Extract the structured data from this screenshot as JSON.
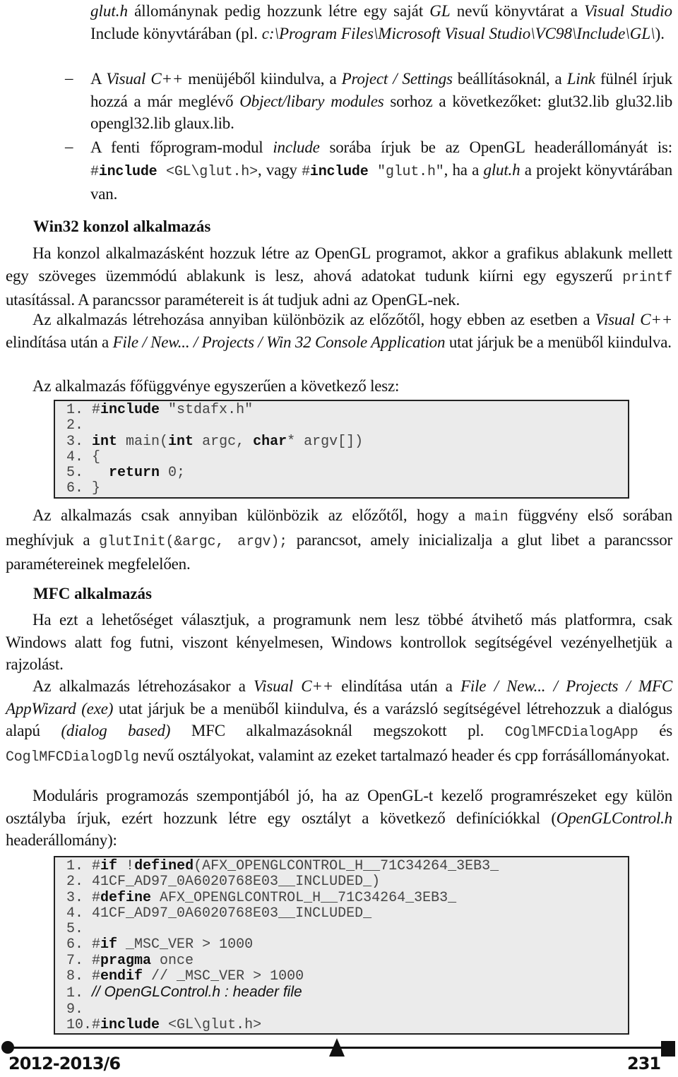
{
  "top_continuation": {
    "l1_a": "glut.h",
    "l1_b": " állománynak pedig hozzunk létre egy saját ",
    "l1_c": "GL",
    "l1_d": " nevű könyvtárat a ",
    "l1_e": "Visual Studio",
    "l1_f": " Include könyvtárában (pl. ",
    "l1_g": "c:\\Program Files\\Microsoft Visual Studio\\VC98\\Include\\GL\\",
    "l1_h": ")."
  },
  "bullets": [
    {
      "dash": "–",
      "p1": "A ",
      "i1": "Visual C++",
      "p2": " menüjéből kiindulva, a ",
      "i2": "Project / Settings",
      "p3": " beállításoknál, a ",
      "i3": "Link",
      "p4": " fülnél írjuk hozzá a már meglévő ",
      "i4": "Object/libary modules",
      "p5": " sorhoz a következőket: glut32.lib glu32.lib opengl32.lib glaux.lib."
    },
    {
      "dash": "–",
      "p1": "A fenti főprogram-modul ",
      "i1": "include",
      "p2": " sorába írjuk be az OpenGL headerállományát is: ",
      "c1_hash": "#",
      "c1_kw": "include",
      "c1_rest": " <GL\\glut.h>",
      "p3": ", vagy ",
      "c2_hash": "#",
      "c2_kw": "include",
      "c2_rest": " \"glut.h\"",
      "p4": ", ha a ",
      "i2": "glut.h",
      "p5": " a projekt könyvtárában van."
    }
  ],
  "section_win32": {
    "heading": "Win32 konzol alkalmazás",
    "para1_a": "Ha konzol alkalmazásként hozzuk létre az OpenGL programot, akkor a grafikus ablakunk mellett egy szöveges üzemmódú ablakunk is lesz, ahová adatokat tudunk kiírni egy egyszerű ",
    "para1_code": "printf",
    "para1_b": " utasítással. A parancssor paramétereit is át tudjuk adni az OpenGL-nek.",
    "para2_a": "Az alkalmazás létrehozása annyiban különbözik az előzőtől, hogy ebben az esetben a ",
    "para2_i1": "Visual C++",
    "para2_b": " elindítása után a ",
    "para2_i2": "File / New... / Projects / Win 32 Console Application",
    "para2_c": " utat járjuk be a menüből kiindulva.",
    "para3": "Az alkalmazás főfüggvénye egyszerűen a következő lesz:",
    "code": [
      {
        "num": "1. ",
        "hash": "#",
        "kw": "include",
        "rest": " \"stdafx.h\""
      },
      {
        "num": "2. ",
        "hash": "",
        "kw": "",
        "rest": ""
      },
      {
        "num": "3. ",
        "kw1": "int",
        "r1": " main(",
        "kw2": "int",
        "r2": " argc, ",
        "kw3": "char",
        "r3": "* argv[])"
      },
      {
        "num": "4. ",
        "hash": "",
        "kw": "",
        "rest": "{"
      },
      {
        "num": "5. ",
        "hash": "  ",
        "kw": "return",
        "rest": " 0;"
      },
      {
        "num": "6. ",
        "hash": "",
        "kw": "",
        "rest": "}"
      }
    ],
    "para4_a": "Az alkalmazás csak annyiban különbözik az előzőtől, hogy a ",
    "para4_code1": "main",
    "para4_b": " függvény első sorában meghívjuk a ",
    "para4_code2": "glutInit(&argc, argv);",
    "para4_c": " parancsot, amely inicializalja a glut libet a parancssor paramétereinek megfelelően."
  },
  "section_mfc": {
    "heading": "MFC alkalmazás",
    "para1": "Ha ezt a lehetőséget választjuk, a programunk nem lesz többé átvihető más platformra, csak Windows alatt fog futni, viszont kényelmesen, Windows kontrollok segítségével vezényelhetjük a rajzolást.",
    "para2_a": "Az alkalmazás létrehozásakor a ",
    "para2_i1": "Visual C++",
    "para2_b": " elindítása után a ",
    "para2_i2": "File / New... / Projects / MFC AppWizard (exe)",
    "para2_c": " utat járjuk be a menüből kiindulva, és a varázsló segítségével létrehozzuk a dialógus alapú ",
    "para2_i3": "(dialog based)",
    "para2_d": " MFC alkalmazásoknál megszokott pl. ",
    "para2_code1": "COglMFCDialogApp",
    "para2_e": " és ",
    "para2_code2": "CoglMFCDialogDlg",
    "para2_f": " nevű osztályokat, valamint az ezeket tartalmazó header és cpp forrásállományokat.",
    "para3_a": "Moduláris programozás szempontjából jó, ha az OpenGL-t kezelő programrészeket egy külön osztályba írjuk, ezért hozzunk létre egy osztályt a következő definíciókkal (",
    "para3_i1": "OpenGLControl.h",
    "para3_b": " headerállomány):",
    "code": [
      {
        "num": "1. ",
        "hash": "#",
        "kw": "if",
        "mid": " !",
        "kw2": "defined",
        "rest": "(AFX_OPENGLCONTROL_H__71C34264_3EB3_"
      },
      {
        "num": "2. ",
        "hash": "",
        "kw": "",
        "mid": "",
        "kw2": "",
        "rest": "41CF_AD97_0A6020768E03__INCLUDED_)"
      },
      {
        "num": "3. ",
        "hash": "#",
        "kw": "define",
        "mid": "",
        "kw2": "",
        "rest": " AFX_OPENGLCONTROL_H__71C34264_3EB3_"
      },
      {
        "num": "4. ",
        "hash": "",
        "kw": "",
        "mid": "",
        "kw2": "",
        "rest": "41CF_AD97_0A6020768E03__INCLUDED_"
      },
      {
        "num": "5. ",
        "hash": "",
        "kw": "",
        "mid": "",
        "kw2": "",
        "rest": ""
      },
      {
        "num": "6. ",
        "hash": "#",
        "kw": "if",
        "mid": "",
        "kw2": "",
        "rest": " _MSC_VER > 1000"
      },
      {
        "num": "7. ",
        "hash": "#",
        "kw": "pragma",
        "mid": "",
        "kw2": "",
        "rest": " once"
      },
      {
        "num": "8. ",
        "hash": "#",
        "kw": "endif",
        "mid": "",
        "kw2": "",
        "rest": " // _MSC_VER > 1000"
      },
      {
        "num": "1. ",
        "comment": "// OpenGLControl.h : header file"
      },
      {
        "num": "9. ",
        "hash": "",
        "kw": "",
        "mid": "",
        "kw2": "",
        "rest": ""
      },
      {
        "num": "10.",
        "hash": "#",
        "kw": "include",
        "mid": "",
        "kw2": "",
        "rest": " <GL\\glut.h>"
      }
    ]
  },
  "footer": {
    "left": "2012-2013/6",
    "right": "231"
  }
}
